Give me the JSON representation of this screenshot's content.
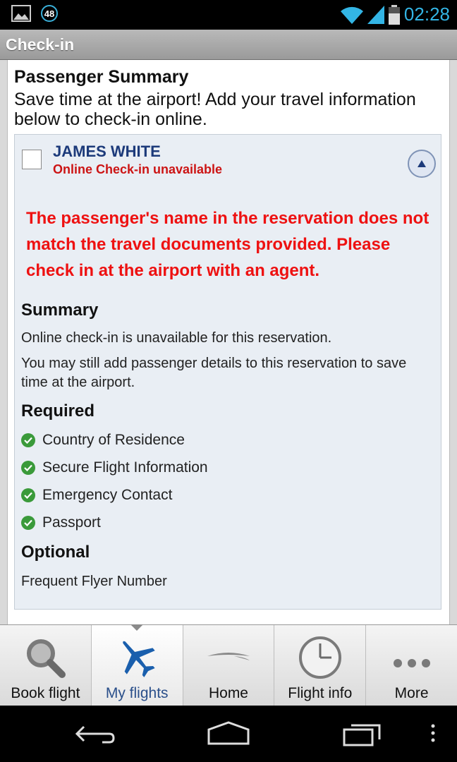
{
  "status_bar": {
    "notification_count": "48",
    "time": "02:28",
    "icons": [
      "image-icon",
      "wifi-icon",
      "signal-icon",
      "battery-icon"
    ]
  },
  "titlebar": {
    "title": "Check-in"
  },
  "content": {
    "heading": "Passenger Summary",
    "intro": "Save time at the airport! Add your travel information below to check-in online.",
    "passenger": {
      "name": "JAMES WHITE",
      "status": "Online Check-in unavailable",
      "warning": "The passenger's name in the reservation does not match the travel documents provided. Please check in at the airport with an agent.",
      "summary_heading": "Summary",
      "summary_line1": "Online check-in is unavailable for this reservation.",
      "summary_line2": "You may still add passenger details to this reservation to save time at the airport.",
      "required_heading": "Required",
      "required_items": [
        "Country of Residence",
        "Secure Flight Information",
        "Emergency Contact",
        "Passport"
      ],
      "optional_heading": "Optional",
      "optional_items": [
        "Frequent Flyer Number"
      ]
    }
  },
  "tabs": [
    {
      "label": "Book flight",
      "icon": "search-icon",
      "active": false
    },
    {
      "label": "My flights",
      "icon": "airplane-icon",
      "active": true
    },
    {
      "label": "Home",
      "icon": "speedmarque-icon",
      "active": false
    },
    {
      "label": "Flight info",
      "icon": "clock-icon",
      "active": false
    },
    {
      "label": "More",
      "icon": "more-icon",
      "active": false
    }
  ],
  "colors": {
    "accent": "#33b5e5",
    "error": "#ee1111",
    "name_blue": "#1c3a7a",
    "check_green": "#3a9a3a",
    "active_tab_text": "#2a4f8a"
  }
}
